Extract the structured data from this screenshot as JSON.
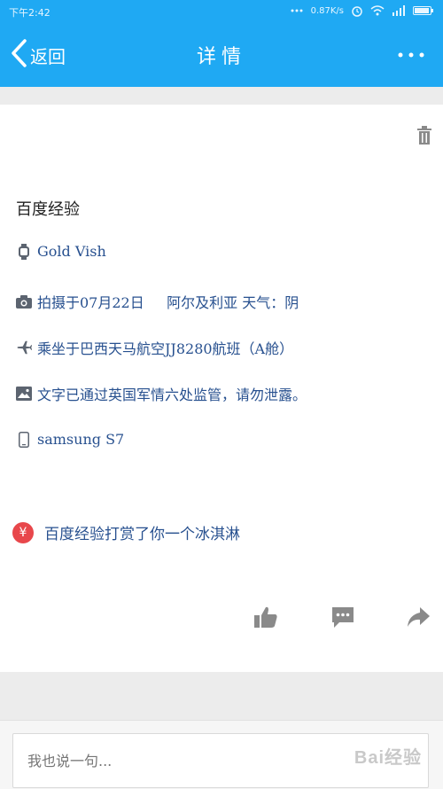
{
  "status_bar": {
    "time": "下午2:42",
    "network_speed": "0.87K/s",
    "icons": [
      "signal-dots-icon",
      "alarm-icon",
      "wifi-icon",
      "cell-signal-icon",
      "battery-icon"
    ]
  },
  "nav": {
    "back_label": "返回",
    "title": "详情",
    "more_icon": "more-dots-icon"
  },
  "detail": {
    "title": "百度经验",
    "rows": [
      {
        "icon": "watch-icon",
        "text": "Gold Vish"
      },
      {
        "icon": "camera-icon",
        "text": "拍摄于07月22日     阿尔及利亚 天气：阴"
      },
      {
        "icon": "airplane-icon",
        "text": "乘坐于巴西天马航空JJ8280航班（A舱）"
      },
      {
        "icon": "image-icon",
        "text": "文字已通过英国军情六处监管，请勿泄露。"
      },
      {
        "icon": "phone-icon",
        "text": "samsung S7"
      }
    ],
    "reward": {
      "icon_text": "¥",
      "text": "百度经验打赏了你一个冰淇淋"
    }
  },
  "actions": {
    "like_icon": "thumbs-up-icon",
    "comment_icon": "comment-icon",
    "share_icon": "share-icon"
  },
  "comment": {
    "placeholder": "我也说一句..."
  },
  "watermark": "Bai经验",
  "colors": {
    "accent": "#1fa9f3",
    "text_blue": "#27508f",
    "reward_red": "#e8474b",
    "icon_gray": "#8a8a8a"
  }
}
